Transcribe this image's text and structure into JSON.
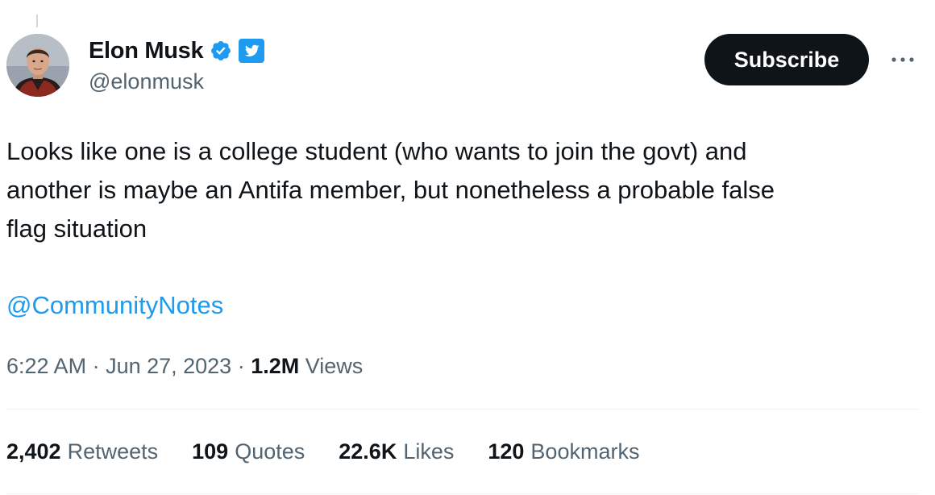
{
  "author": {
    "display_name": "Elon Musk",
    "handle": "@elonmusk",
    "avatar_icon": "profile-photo",
    "verified_icon": "verified-badge-icon",
    "affiliation_icon": "twitter-bird-icon"
  },
  "actions": {
    "subscribe_label": "Subscribe",
    "more_icon": "more-options-icon"
  },
  "tweet": {
    "text": "Looks like one is a college student (who wants to join the govt) and\nanother is maybe an Antifa member, but nonetheless a probable false\nflag situation",
    "mention": "@CommunityNotes"
  },
  "meta": {
    "time": "6:22 AM",
    "separator": " · ",
    "date": "Jun 27, 2023",
    "views_count": "1.2M",
    "views_label": "Views"
  },
  "stats": [
    {
      "count": "2,402",
      "label": "Retweets"
    },
    {
      "count": "109",
      "label": "Quotes"
    },
    {
      "count": "22.6K",
      "label": "Likes"
    },
    {
      "count": "120",
      "label": "Bookmarks"
    }
  ],
  "colors": {
    "text": "#0f1419",
    "secondary": "#536471",
    "link": "#1d9bf0",
    "button_bg": "#0f1419",
    "divider": "#eff3f4"
  }
}
